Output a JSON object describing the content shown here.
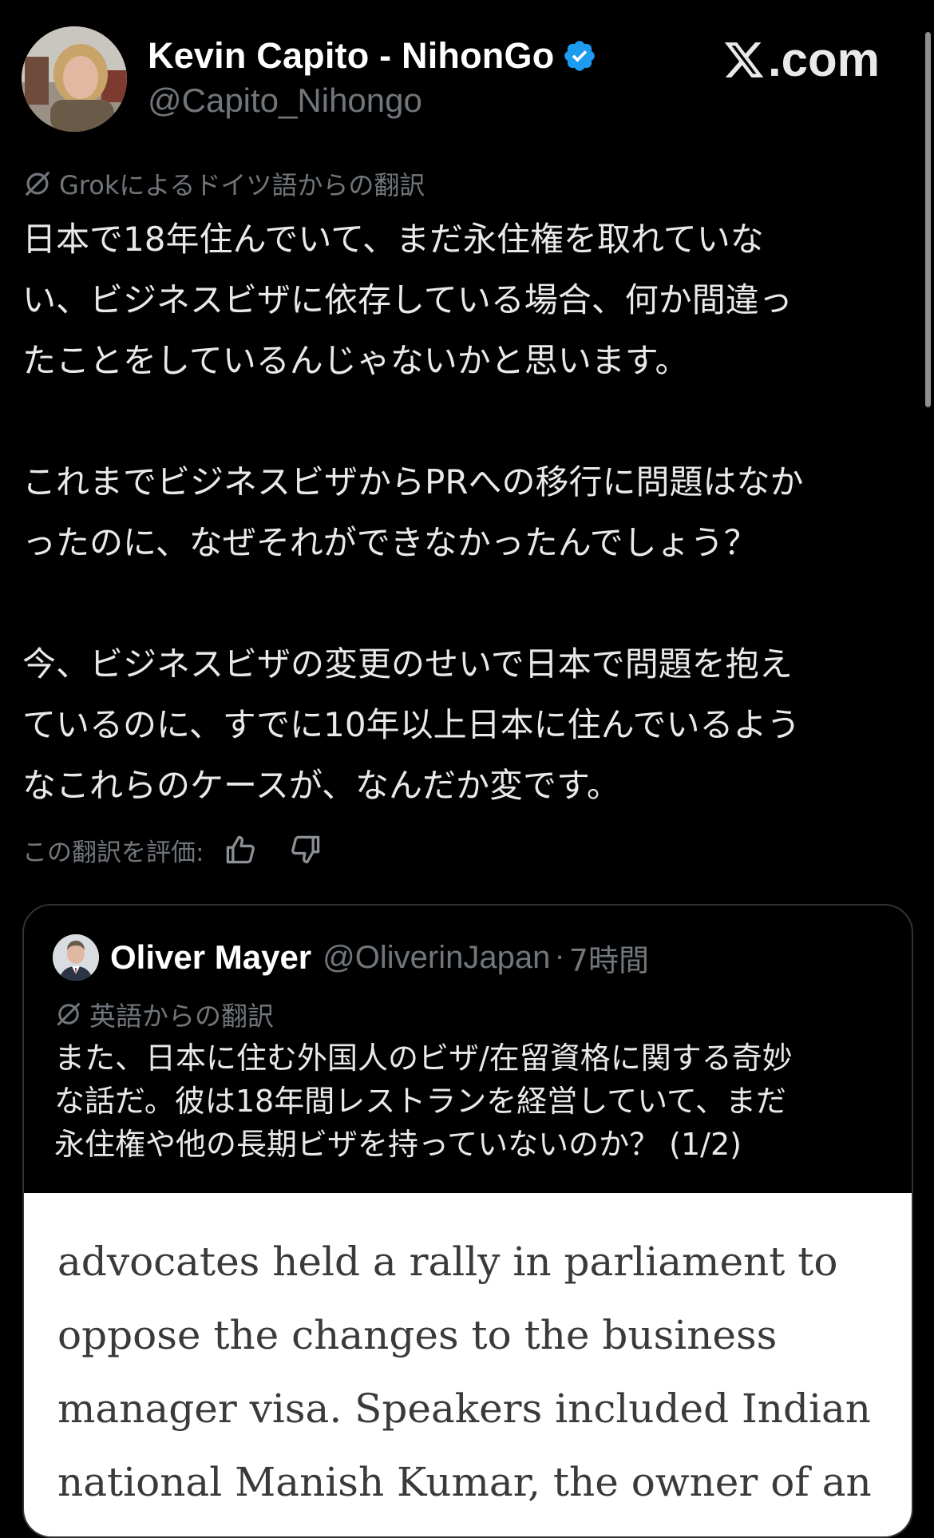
{
  "author": {
    "display_name": "Kevin Capito - NihonGo",
    "handle": "@Capito_Nihongo",
    "verified_icon": "verified-badge-icon"
  },
  "site_brand": {
    "label": ".com",
    "icon": "x-logo-icon"
  },
  "translation_note": "Grokによるドイツ語からの翻訳",
  "tweet": {
    "paragraphs": [
      [
        "日本で18年住んでいて、まだ永住権を取れていな",
        "い、ビジネスビザに依存している場合、何か間違っ",
        "たことをしているんじゃないかと思います。"
      ],
      [
        "これまでビジネスビザからPRへの移行に問題はなか",
        "ったのに、なぜそれができなかったんでしょう？"
      ],
      [
        "今、ビジネスビザの変更のせいで日本で問題を抱え",
        "ているのに、すでに10年以上日本に住んでいるよう",
        "なこれらのケースが、なんだか変です。"
      ]
    ]
  },
  "rate_translation": {
    "label": "この翻訳を評価:",
    "like_icon": "thumbs-up-icon",
    "dislike_icon": "thumbs-down-icon"
  },
  "quote": {
    "display_name": "Oliver Mayer",
    "handle": "@OliverinJapan",
    "separator": "·",
    "time": "7時間",
    "translation_note": "英語からの翻訳",
    "lines": [
      "また、日本に住む外国人のビザ/在留資格に関する奇妙",
      "な話だ。彼は18年間レストランを経営していて、まだ",
      "永住権や他の長期ビザを持っていないのか？ (1/2)"
    ],
    "media_text": [
      "advocates held a rally in parliament to",
      "oppose the changes to the business",
      "manager visa. Speakers included Indian",
      "national Manish Kumar, the owner of an"
    ]
  },
  "colors": {
    "background": "#000000",
    "text": "#e7e9ea",
    "secondary": "#71767b",
    "verified_blue": "#1d9bf0",
    "card_border": "#2f3336"
  }
}
